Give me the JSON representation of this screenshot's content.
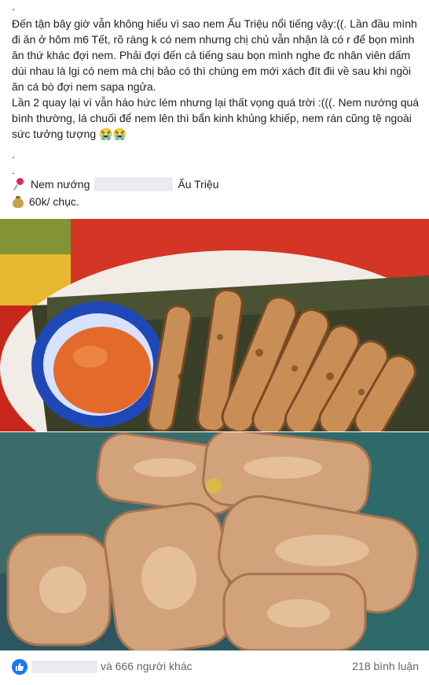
{
  "post": {
    "paragraph1": [
      ".",
      "Đến tận bây giờ vẫn không hiểu vì sao nem Ấu Triệu nổi tiếng vậy:((. Lần đầu mình đi ăn ở hôm m6 Tết, rõ ràng k có nem nhưng chị chủ vẫn nhận là có r để bọn mình ăn thứ khác đợi nem. Phải đợi đến cả tiếng sau bọn mình nghe đc nhân viên dấm dúi nhau là lgi có nem mà chị bảo có thì chúng em mới xách đít đii về sau khi ngồi ăn cá bò đợi nem sapa ngửa.",
      "Lần 2 quay lại vì vẫn háo hức lém nhưng lại thất vọng quá trời :(((. Nem nướng quá bình thường, lá chuối để nem lên thì bẩn kinh khủng khiếp, nem rán cũng tệ ngoài sức tưởng tượng 😭😭"
    ],
    "dots": [
      ".",
      "."
    ],
    "location_prefix": "Nem nướng",
    "location_suffix": "Ấu Triệu",
    "price": "60k/ chục.",
    "location_icon": "round-pushpin-icon",
    "price_icon": "money-bag-icon"
  },
  "footer": {
    "likes_text": "và 666 người khác",
    "comments_text": "218 bình luận",
    "like_icon": "thumbs-up-icon",
    "like_color": "#1877f2"
  },
  "photos": [
    {
      "subject": "grilled-nem-on-banana-leaf"
    },
    {
      "subject": "fried-nem-on-banana-leaf"
    }
  ]
}
